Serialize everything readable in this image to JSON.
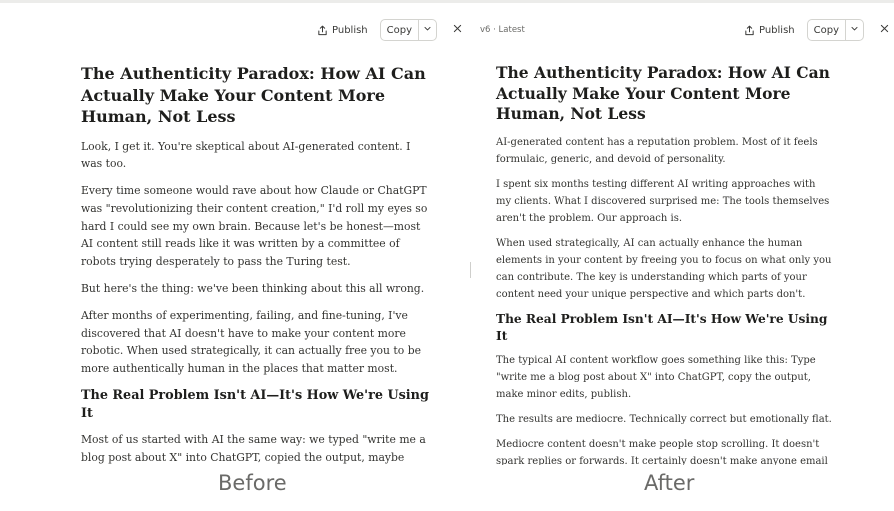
{
  "before": {
    "toolbar": {
      "publish_label": "Publish",
      "copy_label": "Copy"
    },
    "title": "The Authenticity Paradox: How AI Can Actually Make Your Content More Human, Not Less",
    "paragraphs_1": [
      "Look, I get it. You're skeptical about AI-generated content. I was too.",
      "Every time someone would rave about how Claude or ChatGPT was \"revolutionizing their content creation,\" I'd roll my eyes so hard I could see my own brain. Because let's be honest—most AI content still reads like it was written by a committee of robots trying desperately to pass the Turing test.",
      "But here's the thing: we've been thinking about this all wrong.",
      "After months of experimenting, failing, and fine-tuning, I've discovered that AI doesn't have to make your content more robotic. When used strategically, it can actually free you to be more authentically human in the places that matter most."
    ],
    "heading_2": "The Real Problem Isn't AI—It's How We're Using It",
    "paragraphs_2": [
      "Most of us started with AI the same way: we typed \"write me a blog post about X\" into ChatGPT, copied the output, maybe tweaked a few sentences, and hit publish."
    ],
    "caption": "Before"
  },
  "after": {
    "toolbar": {
      "version_label": "v6 · Latest",
      "publish_label": "Publish",
      "copy_label": "Copy"
    },
    "title": "The Authenticity Paradox: How AI Can Actually Make Your Content More Human, Not Less",
    "paragraphs_1": [
      "AI-generated content has a reputation problem. Most of it feels formulaic, generic, and devoid of personality.",
      "I spent six months testing different AI writing approaches with my clients. What I discovered surprised me: The tools themselves aren't the problem. Our approach is.",
      "When used strategically, AI can actually enhance the human elements in your content by freeing you to focus on what only you can contribute. The key is understanding which parts of your content need your unique perspective and which parts don't."
    ],
    "heading_2": "The Real Problem Isn't AI—It's How We're Using It",
    "paragraphs_2": [
      "The typical AI content workflow goes something like this: Type \"write me a blog post about X\" into ChatGPT, copy the output, make minor edits, publish.",
      "The results are mediocre. Technically correct but emotionally flat.",
      "Mediocre content doesn't make people stop scrolling. It doesn't spark replies or forwards. It certainly doesn't make anyone email you at"
    ],
    "caption": "After"
  },
  "icons": {
    "publish": "share-upload-icon",
    "caret": "chevron-down-icon",
    "close": "close-icon"
  }
}
